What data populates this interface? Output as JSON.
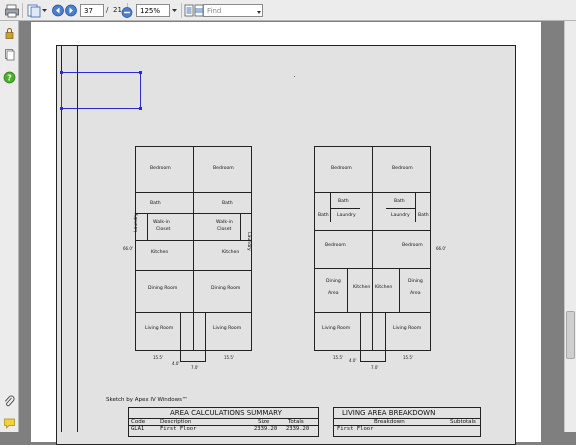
{
  "toolbar": {
    "page_current": "37",
    "page_separator": "/",
    "page_total": "21",
    "zoom": "125%",
    "find_placeholder": "Find"
  },
  "drawing": {
    "credit": "Sketch by Apex IV Windows™",
    "left_plan": {
      "rooms": [
        "Bedroom",
        "Bedroom",
        "Bath",
        "Bath",
        "Walk-in",
        "Closet",
        "Walk-in",
        "Closet",
        "Laundry",
        "Laundry",
        "Kitchen",
        "Kitchen",
        "Dining Room",
        "Dining Room",
        "Living Room",
        "Living Room"
      ],
      "dims": [
        "66.0'",
        "15.5'",
        "15.5'",
        "4.0'",
        "7.0'"
      ]
    },
    "right_plan": {
      "rooms": [
        "Bedroom",
        "Bedroom",
        "Bath",
        "Bath",
        "Bath",
        "Bath",
        "Laundry",
        "Laundry",
        "Bedroom",
        "Bedroom",
        "Dining",
        "Area",
        "Kitchen",
        "Kitchen",
        "Dining",
        "Area",
        "Living Room",
        "Living Room"
      ],
      "dims": [
        "66.0'",
        "15.5'",
        "15.5'",
        "4.0'",
        "7.0'"
      ]
    }
  },
  "area_table": {
    "title": "AREA CALCULATIONS SUMMARY",
    "headers": [
      "Code",
      "Description",
      "Size",
      "Totals"
    ],
    "row": [
      "GLA1",
      "First Floor",
      "2339.20",
      "2339.20"
    ]
  },
  "living_table": {
    "title": "LIVING AREA BREAKDOWN",
    "headers": [
      "Breakdown",
      "Subtotals"
    ],
    "row": [
      "First Floor"
    ]
  }
}
